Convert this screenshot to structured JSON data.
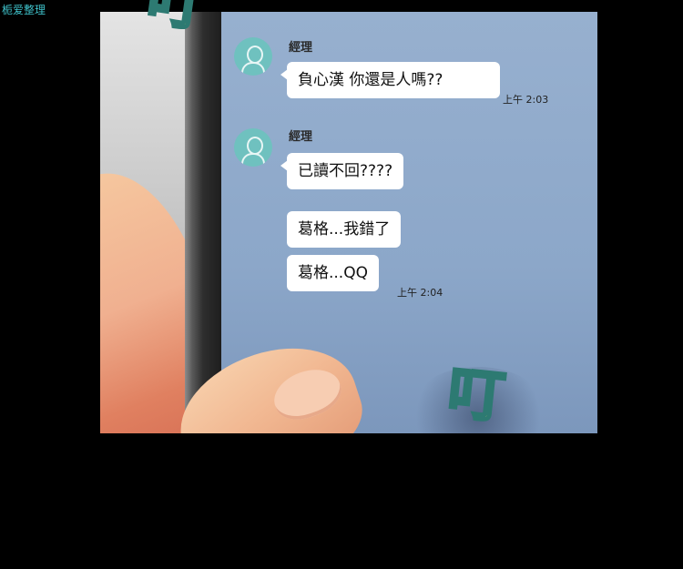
{
  "watermark": "栀爱整理",
  "chat": {
    "groups": [
      {
        "sender": "經理",
        "messages": [
          "負心漢 你還是人嗎??"
        ],
        "time": "上午 2:03"
      },
      {
        "sender": "經理",
        "messages": [
          "已讀不回????",
          "葛格...我錯了",
          "葛格...QQ"
        ],
        "time": "上午 2:04"
      }
    ]
  },
  "sfx": {
    "top": "叮",
    "bottom": "叮"
  },
  "colors": {
    "screen_bg": "#8ea8c8",
    "avatar": "#6fc1bf",
    "sfx_fill": "#f2e66a",
    "sfx_outline": "#2d7a72"
  },
  "icons": {
    "avatar": "user-silhouette-icon"
  }
}
